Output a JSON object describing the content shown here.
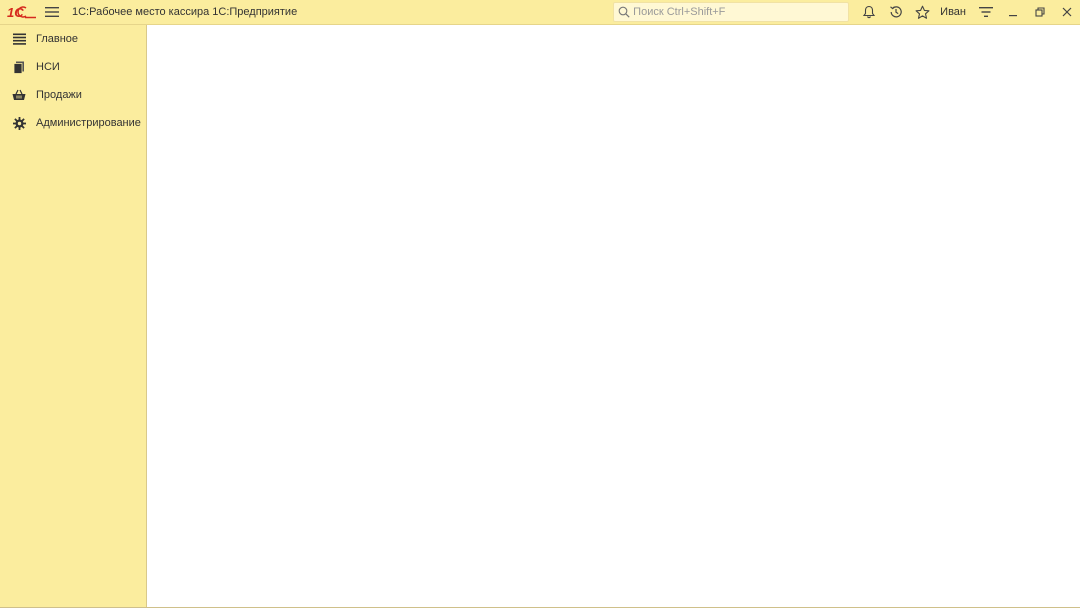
{
  "app": {
    "title": "1С:Рабочее место кассира 1С:Предприятие",
    "logo_text": "1С"
  },
  "search": {
    "placeholder": "Поиск Ctrl+Shift+F"
  },
  "user": {
    "name": "Иван"
  },
  "icons": {
    "menu": "hamburger-icon",
    "search": "search-icon",
    "notifications": "bell-icon",
    "history": "history-icon",
    "favorites": "star-icon",
    "settings": "filter-icon",
    "minimize": "minimize-icon",
    "restore": "restore-icon",
    "close": "close-icon"
  },
  "sidebar": {
    "items": [
      {
        "label": "Главное",
        "icon": "list-icon"
      },
      {
        "label": "НСИ",
        "icon": "books-icon"
      },
      {
        "label": "Продажи",
        "icon": "basket-icon"
      },
      {
        "label": "Администрирование",
        "icon": "gear-icon"
      }
    ]
  },
  "colors": {
    "panel_bg": "#fbed9e",
    "logo_red": "#d52b1e",
    "content_bg": "#ffffff"
  }
}
